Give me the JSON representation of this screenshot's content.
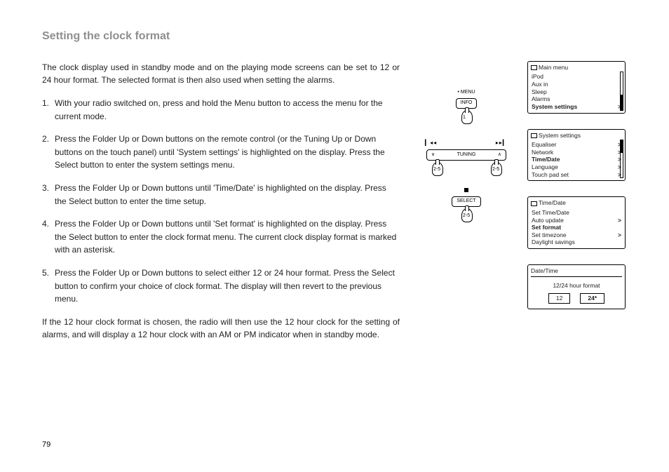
{
  "title": "Setting the clock format",
  "intro": "The clock display used in standby mode and on the playing mode screens can be set to 12 or 24 hour format. The selected format is then also used when setting the alarms.",
  "steps": [
    "With your radio switched on, press and hold the Menu button to access the menu for the current mode.",
    "Press the Folder Up or Down buttons on the remote control (or the Tuning Up or Down buttons on the touch panel) until 'System settings' is highlighted on the display. Press the Select button to enter the system settings menu.",
    "Press the Folder Up or Down buttons until 'Time/Date' is highlighted on the display. Press the Select button to enter the time setup.",
    "Press the Folder Up or Down buttons until 'Set format' is highlighted on the display. Press the Select button to enter the clock format menu. The current clock display format is marked with an asterisk.",
    "Press the Folder Up or Down buttons to select either 12 or 24 hour format. Press the Select button to confirm your choice of clock format. The display will then revert to the previous menu."
  ],
  "outro": "If the 12 hour clock format is chosen, the radio will then use the 12 hour clock for the setting of alarms, and will display a 12 hour clock with an AM or PM indicator when in standby mode.",
  "page_number": "79",
  "remote": {
    "menu_label": "• MENU",
    "info_btn": "INFO",
    "tuning_label": "TUNING",
    "select_btn": "SELECT",
    "step1_tag": "1",
    "step25_tag": "2-5"
  },
  "screens": {
    "main": {
      "header": "Main menu",
      "items": [
        "iPod",
        "Aux in",
        "Sleep",
        "Alarms"
      ],
      "highlight": "System settings"
    },
    "system": {
      "header": "System settings",
      "items": [
        {
          "label": "Equaliser",
          "arrow": true
        },
        {
          "label": "Network",
          "arrow": true
        },
        {
          "label": "Time/Date",
          "arrow": true,
          "bold": true
        },
        {
          "label": "Language",
          "arrow": true
        },
        {
          "label": "Touch pad set",
          "arrow": true
        }
      ]
    },
    "timedate": {
      "header": "Time/Date",
      "items": [
        {
          "label": "Set Time/Date",
          "arrow": false
        },
        {
          "label": "Auto update",
          "arrow": true
        },
        {
          "label": "Set format",
          "arrow": false,
          "bold": true
        },
        {
          "label": "Set timezone",
          "arrow": true
        },
        {
          "label": "Daylight savings",
          "arrow": false
        }
      ]
    },
    "format": {
      "header": "Date/Time",
      "caption": "12/24 hour format",
      "opt12": "12",
      "opt24": "24*"
    }
  }
}
